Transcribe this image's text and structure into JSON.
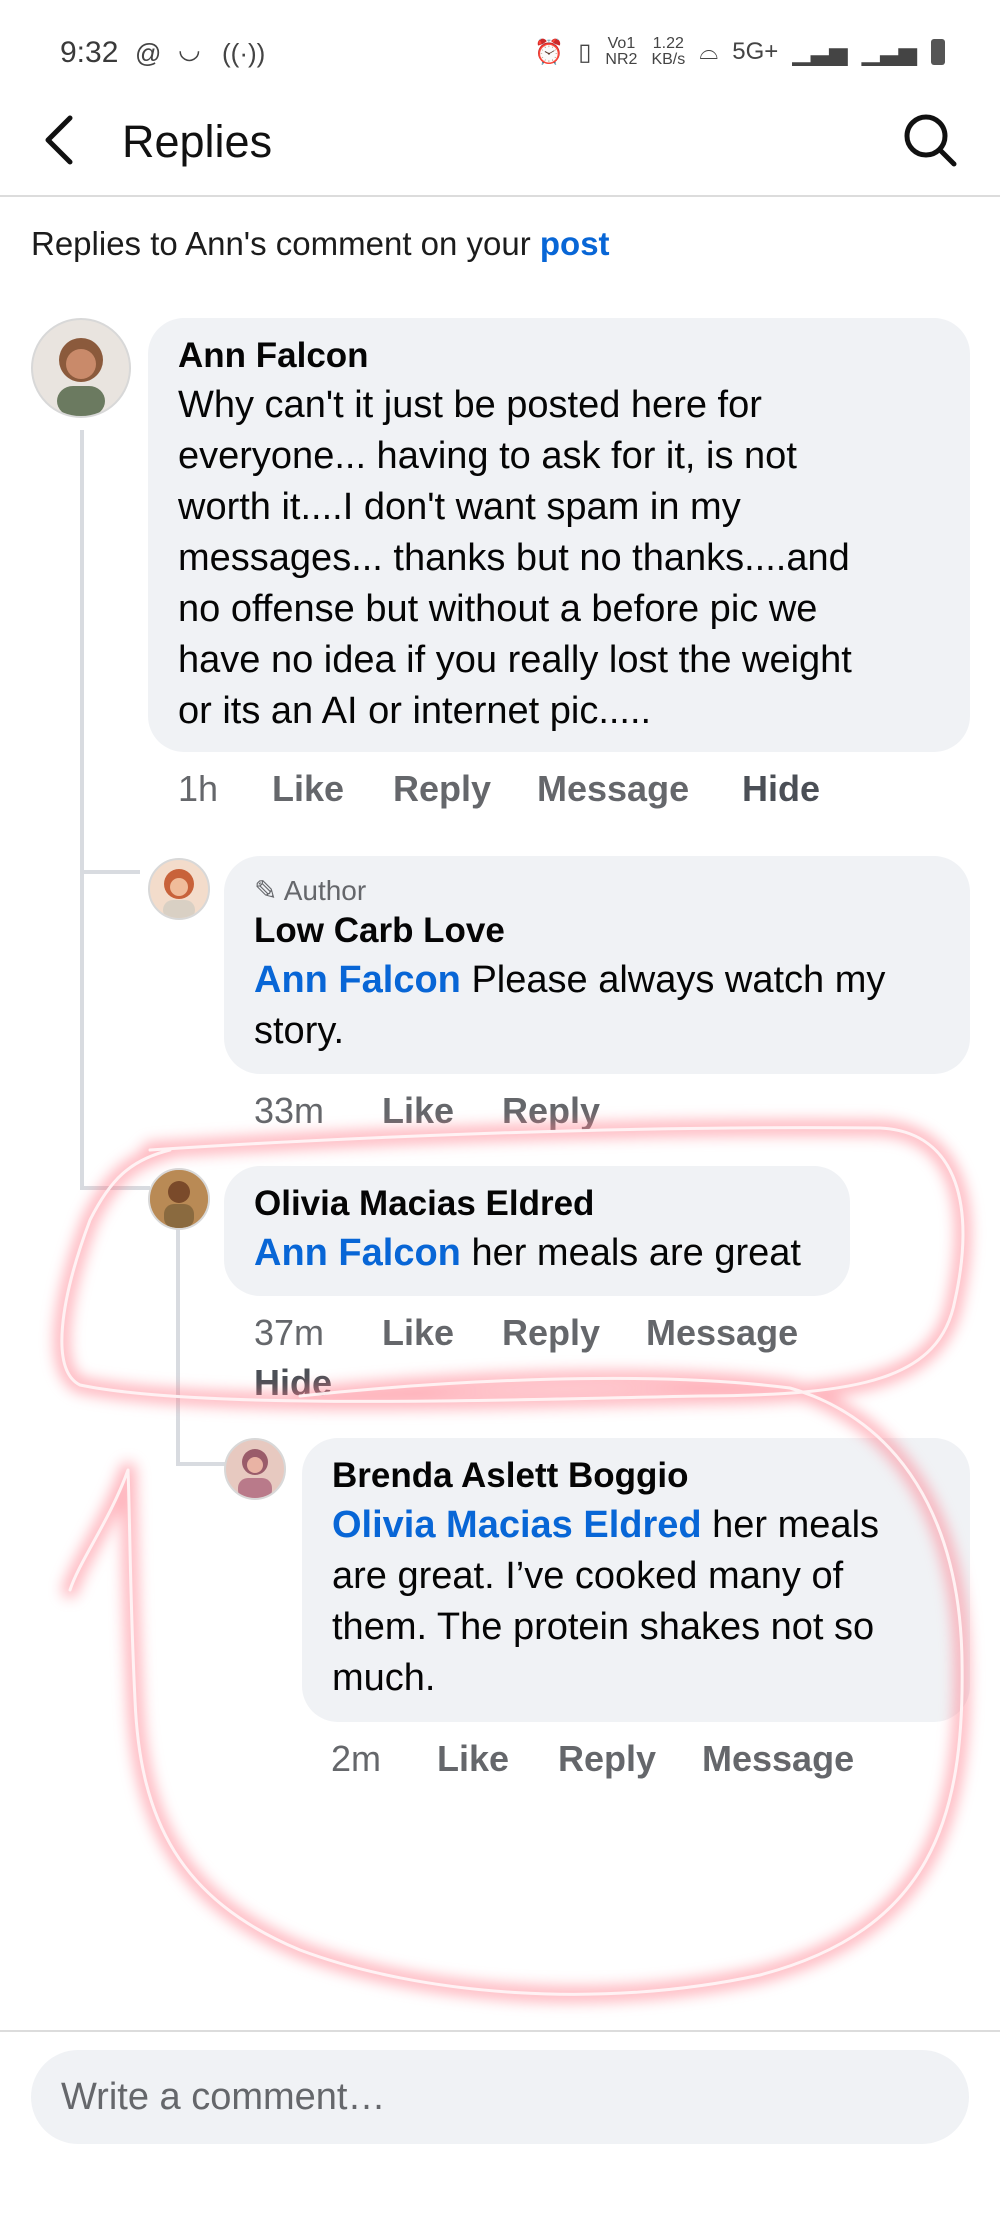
{
  "status_bar": {
    "time": "9:32",
    "left_icons": [
      "threads-icon",
      "amazon-smile-icon",
      "hotspot-icon"
    ],
    "indicators": "⏰ 📳 Vo1 NR2  1.22 KB/s  5G+",
    "speed": "1.22",
    "speed_unit": "KB/s",
    "volte": "Vo1",
    "nr": "NR2",
    "network": "5G+"
  },
  "header": {
    "title": "Replies",
    "back_icon": "chevron-left-icon",
    "search_icon": "search-icon"
  },
  "context": {
    "prefix": "Replies to Ann's comment on your ",
    "link": "post"
  },
  "comments": [
    {
      "name": "Ann Falcon",
      "text": "Why can't it just be posted here for everyone... having to ask for it, is not worth it....I don't want spam in my messages... thanks but no thanks....and no offense but without a before pic we have no idea if you really lost the weight or its an AI or internet pic.....",
      "lines": [
        "Why can't it just be posted here for",
        "everyone... having to ask for it, is not",
        "worth it....I don't want spam in my",
        "messages... thanks but no thanks....and",
        "no offense but without a before pic we",
        "have no idea if you really lost the weight",
        "or its an AI or internet pic....."
      ],
      "time": "1h",
      "actions": [
        "Like",
        "Reply",
        "Message",
        "Hide"
      ]
    },
    {
      "badge": "Author",
      "badge_icon": "pencil-icon",
      "name": "Low Carb Love",
      "mention": "Ann Falcon",
      "text_line1": " Please always watch my",
      "text_line2": "story.",
      "time": "33m",
      "actions": [
        "Like",
        "Reply"
      ]
    },
    {
      "name": "Olivia Macias Eldred",
      "mention": "Ann Falcon",
      "text": " her meals are great",
      "time": "37m",
      "actions": [
        "Like",
        "Reply",
        "Message",
        "Hide"
      ]
    },
    {
      "name": "Brenda Aslett Boggio",
      "mention": "Olivia Macias Eldred",
      "text_line1": " her meals",
      "lines": [
        "are great. I’ve cooked many of",
        "them. The protein shakes not so",
        "much."
      ],
      "time": "2m",
      "actions": [
        "Like",
        "Reply",
        "Message"
      ]
    }
  ],
  "composer": {
    "placeholder": "Write a comment…"
  },
  "annotation_color": "#ff7b8a"
}
